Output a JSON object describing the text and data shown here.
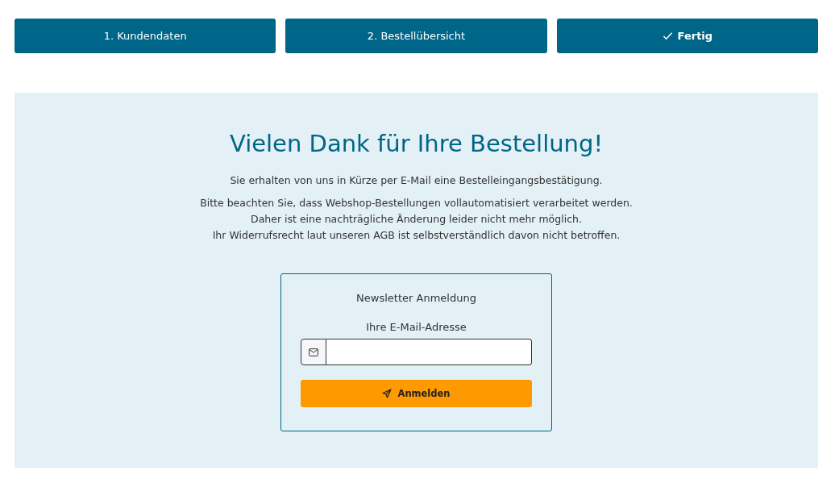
{
  "steps": [
    {
      "label": "1. Kundendaten",
      "selected": false
    },
    {
      "label": "2. Bestellübersicht",
      "selected": false
    },
    {
      "label": "Fertig",
      "selected": true
    }
  ],
  "confirmation": {
    "title": "Vielen Dank für Ihre Bestellung!",
    "paragraphs": [
      [
        "Sie erhalten von uns in Kürze per E-Mail eine Bestelleingangsbestätigung."
      ],
      [
        "Bitte beachten Sie, dass Webshop-Bestellungen vollautomatisiert verarbeitet werden.",
        "Daher ist eine nachträgliche Änderung leider nicht mehr möglich.",
        "Ihr Widerrufsrecht laut unseren AGB ist selbstverständlich davon nicht betroffen."
      ]
    ]
  },
  "newsletter": {
    "title": "Newsletter Anmeldung",
    "email_label": "Ihre E-Mail-Adresse",
    "button": "Anmelden"
  }
}
